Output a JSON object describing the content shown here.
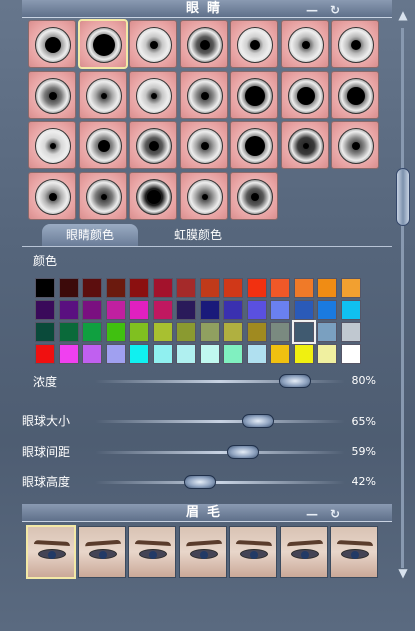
{
  "eyes_section": {
    "title": "眼睛",
    "minimize": "—",
    "reset": "↻"
  },
  "eye_tabs": [
    {
      "label": "眼睛颜色",
      "active": true
    },
    {
      "label": "虹膜颜色",
      "active": false
    }
  ],
  "color_label": "颜色",
  "palette": [
    [
      "#000000",
      "#3c0a0a",
      "#5c0e0e",
      "#6b1a0e",
      "#8b1010",
      "#a3122c",
      "#a52a2a",
      "#c03a1a",
      "#d03818",
      "#f23010",
      "#f05828",
      "#f07a28",
      "#f08c14",
      "#f2a030"
    ],
    [
      "#3a0a5a",
      "#5a1080",
      "#7a1080",
      "#c020a0",
      "#e020c0",
      "#c01860",
      "#2a1a5a",
      "#1a1a7a",
      "#3a30b0",
      "#5a50e0",
      "#6a80f0",
      "#2a5ab8",
      "#1a7ae0",
      "#10c0f0"
    ],
    [
      "#0a4a3a",
      "#0a6a3a",
      "#10a040",
      "#40c010",
      "#80c020",
      "#a8c030",
      "#8a9a30",
      "#90a060",
      "#b0b040",
      "#a08a20",
      "#7a8a80",
      "#405a70",
      "#7aa0c0",
      "#c0c8d0"
    ],
    [
      "#f01010",
      "#f040f0",
      "#c060f0",
      "#a0a0f0",
      "#10f0f0",
      "#90f0f0",
      "#b0f0f0",
      "#c0f8f0",
      "#80f0c0",
      "#b0e0f0",
      "#f0c010",
      "#f0f010",
      "#f0f0a0",
      "#ffffff"
    ]
  ],
  "opacity": {
    "label": "浓度",
    "value": "80%",
    "fraction": 0.8
  },
  "sliders": [
    {
      "label": "眼球大小",
      "value": "65%",
      "fraction": 0.65
    },
    {
      "label": "眼球间距",
      "value": "59%",
      "fraction": 0.59
    },
    {
      "label": "眼球高度",
      "value": "42%",
      "fraction": 0.42
    }
  ],
  "brow_section": {
    "title": "眉毛",
    "minimize": "—",
    "reset": "↻"
  },
  "scrollbar": {
    "up": "▲",
    "down": "▼"
  }
}
